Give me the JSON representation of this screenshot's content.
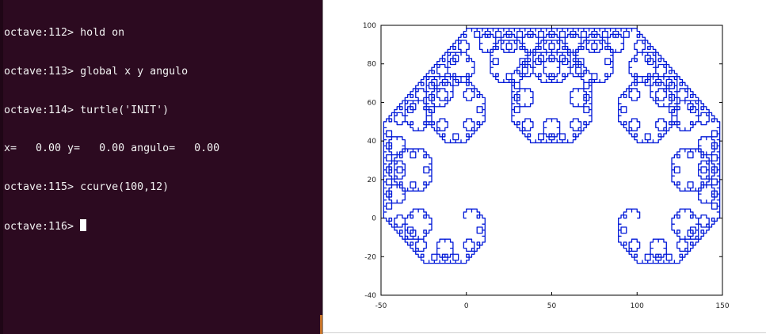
{
  "terminal": {
    "lines": [
      "octave:112> hold on",
      "octave:113> global x y angulo",
      "octave:114> turtle('INIT')",
      "x=   0.00 y=   0.00 angulo=   0.00",
      "octave:115> ccurve(100,12)",
      "octave:116> "
    ],
    "background": "#2c0a20",
    "text_color": "#f2f2f2"
  },
  "plot": {
    "line_color": "#0018d8",
    "chart_data": {
      "type": "line",
      "title": "",
      "xlabel": "",
      "ylabel": "",
      "xlim": [
        -50,
        150
      ],
      "ylim": [
        -40,
        100
      ],
      "xticks": [
        -50,
        0,
        50,
        100,
        150
      ],
      "yticks": [
        -40,
        -20,
        0,
        20,
        40,
        60,
        80,
        100
      ],
      "xtick_labels": [
        "-50",
        "0",
        "50",
        "100",
        "150"
      ],
      "ytick_labels": [
        "-40",
        "-20",
        "0",
        "20",
        "40",
        "60",
        "80",
        "100"
      ],
      "grid": false,
      "series": [
        {
          "generator": "Levy C curve via turtle graphics: ccurve(100,12)",
          "length": 100,
          "order": 12,
          "start": [
            0,
            0
          ],
          "heading_deg": 0
        }
      ]
    }
  }
}
